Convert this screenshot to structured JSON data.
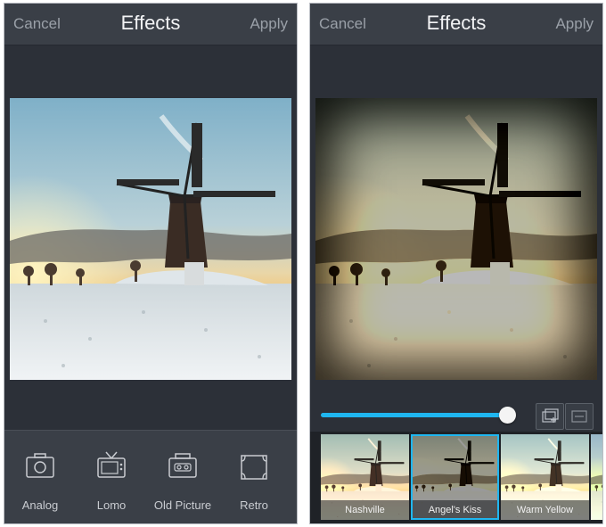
{
  "left_screen": {
    "nav": {
      "cancel": "Cancel",
      "title": "Effects",
      "apply": "Apply"
    },
    "effects": [
      {
        "label": "Analog",
        "icon": "camera-icon"
      },
      {
        "label": "Lomo",
        "icon": "tv-icon"
      },
      {
        "label": "Old Picture",
        "icon": "cassette-icon"
      },
      {
        "label": "Retro",
        "icon": "frame-icon"
      }
    ]
  },
  "right_screen": {
    "nav": {
      "cancel": "Cancel",
      "title": "Effects",
      "apply": "Apply"
    },
    "slider": {
      "level": 0.95
    },
    "buttons": [
      {
        "icon": "add-layer-icon"
      },
      {
        "icon": "compare-icon"
      }
    ],
    "filters": [
      {
        "label": "Nashville",
        "selected": false
      },
      {
        "label": "Angel's Kiss",
        "selected": true
      },
      {
        "label": "Warm Yellow",
        "selected": false
      }
    ]
  },
  "colors": {
    "accent": "#1fb6f0",
    "toolbar": "#3a3f47",
    "background": "#2c3038"
  }
}
